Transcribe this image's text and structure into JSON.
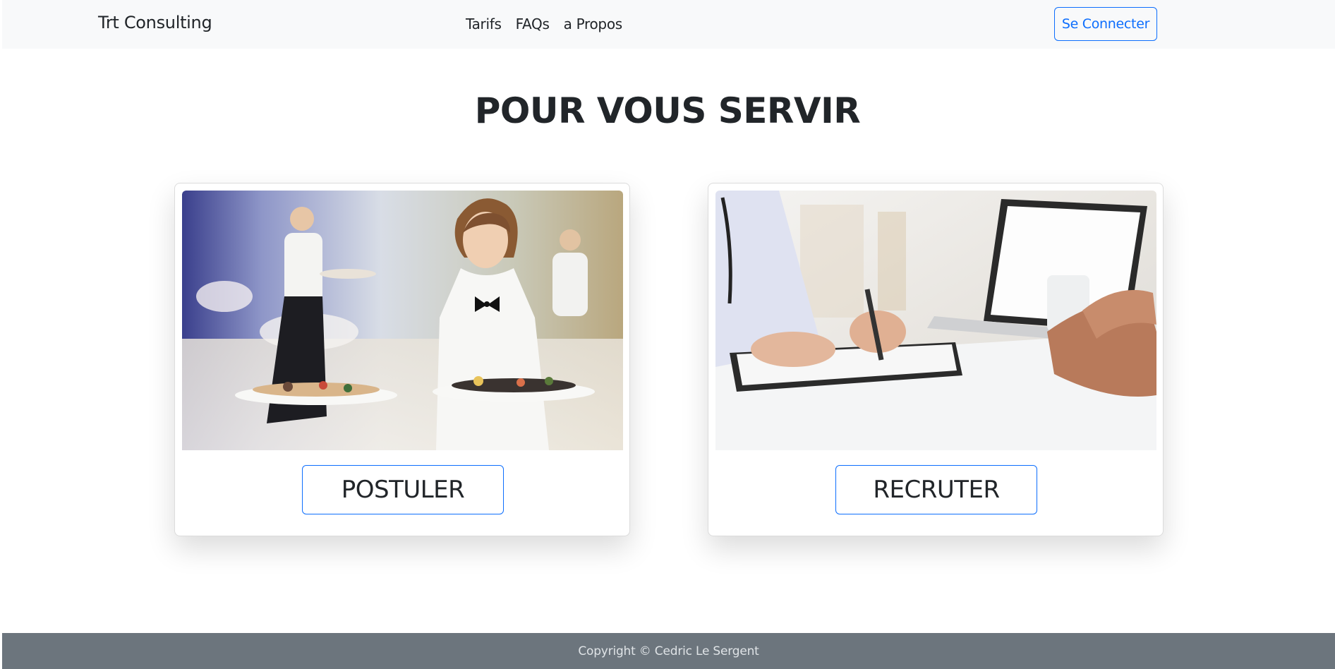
{
  "navbar": {
    "brand": "Trt Consulting",
    "links": [
      "Tarifs",
      "FAQs",
      "a Propos"
    ],
    "login_label": "Se Connecter",
    "background": "#f8f9fa"
  },
  "main": {
    "title": "POUR VOUS SERVIR",
    "cards": [
      {
        "image": "waitress-serving-plates-photo",
        "button_label": "POSTULER"
      },
      {
        "image": "doctor-signing-document-photo",
        "button_label": "RECRUTER"
      }
    ]
  },
  "footer": {
    "text": "Copyright © Cedric Le Sergent",
    "background": "#6c757d"
  },
  "colors": {
    "accent": "#0d6efd",
    "text": "#212529"
  }
}
